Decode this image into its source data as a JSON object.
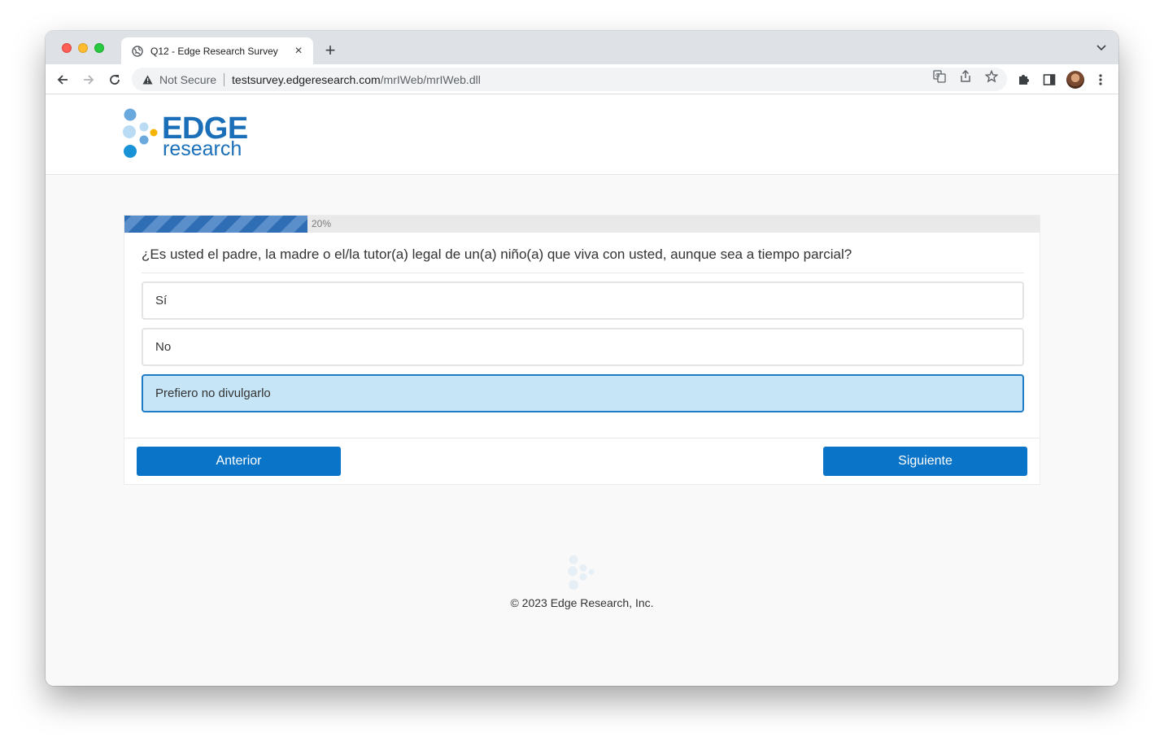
{
  "browser": {
    "tab": {
      "title": "Q12 - Edge Research Survey"
    },
    "address": {
      "security_label": "Not Secure",
      "host": "testsurvey.edgeresearch.com",
      "path": "/mrIWeb/mrIWeb.dll"
    }
  },
  "brand": {
    "line1": "EDGE",
    "line2": "research"
  },
  "survey": {
    "progress": {
      "value": 0.2,
      "label": "20%"
    },
    "question": "¿Es usted el padre, la madre o el/la tutor(a) legal de un(a) niño(a) que viva con usted, aunque sea a tiempo parcial?",
    "options": [
      {
        "label": "Sí",
        "selected": false
      },
      {
        "label": "No",
        "selected": false
      },
      {
        "label": "Prefiero no divulgarlo",
        "selected": true
      }
    ],
    "prev_label": "Anterior",
    "next_label": "Siguiente"
  },
  "footer": {
    "copyright": "© 2023 Edge Research, Inc."
  },
  "colors": {
    "accent": "#0a74c8",
    "selected_bg": "#c6e5f7",
    "selected_border": "#1e7bc6",
    "logo_blue": "#1a6fb8"
  },
  "icons": {
    "favicon": "globe-icon",
    "security": "warning-triangle-icon",
    "translate": "translate-icon",
    "share": "share-icon",
    "bookmark": "star-icon",
    "extensions": "puzzle-icon",
    "sidepanel": "side-panel-icon",
    "menu": "kebab-menu-icon"
  }
}
